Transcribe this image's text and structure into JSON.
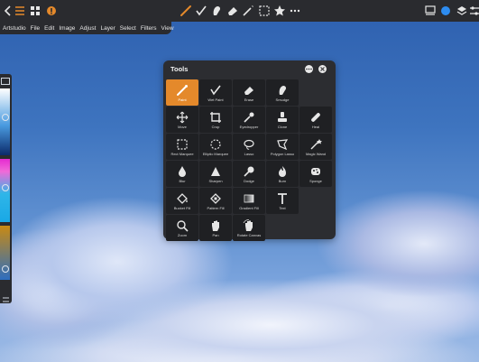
{
  "app": {
    "menu": [
      "Artstudio",
      "File",
      "Edit",
      "Image",
      "Adjust",
      "Layer",
      "Select",
      "Filters",
      "View"
    ]
  },
  "topbar": {
    "left_icons": [
      "back-icon",
      "menu-lines-icon",
      "grid-icon",
      "info-icon"
    ],
    "center_icons": [
      "brush-icon",
      "check-brush-icon",
      "smudge-icon",
      "eraser-icon",
      "selection-icon",
      "star-icon",
      "more-icon"
    ],
    "right_icons": [
      "layers-thumbnail-icon",
      "color-dot-icon",
      "layers-icon",
      "sliders-icon"
    ],
    "accent_color": "#2d8cf0"
  },
  "tools_panel": {
    "title": "Tools",
    "tools": [
      {
        "label": "Paint",
        "icon": "paint-icon",
        "active": true
      },
      {
        "label": "Wet Paint",
        "icon": "wet-paint-icon",
        "active": false
      },
      {
        "label": "Erase",
        "icon": "erase-icon",
        "active": false
      },
      {
        "label": "Smudge",
        "icon": "smudge-icon",
        "active": false
      },
      {
        "label": "",
        "icon": "",
        "active": false
      },
      {
        "label": "Move",
        "icon": "move-icon",
        "active": false
      },
      {
        "label": "Crop",
        "icon": "crop-icon",
        "active": false
      },
      {
        "label": "Eyedropper",
        "icon": "eyedropper-icon",
        "active": false
      },
      {
        "label": "Clone",
        "icon": "clone-icon",
        "active": false
      },
      {
        "label": "Heal",
        "icon": "heal-icon",
        "active": false
      },
      {
        "label": "Rect Marquee",
        "icon": "rect-marquee-icon",
        "active": false
      },
      {
        "label": "Elliptic Marquee",
        "icon": "elliptic-marquee-icon",
        "active": false
      },
      {
        "label": "Lasso",
        "icon": "lasso-icon",
        "active": false
      },
      {
        "label": "Polygon Lasso",
        "icon": "polygon-lasso-icon",
        "active": false
      },
      {
        "label": "Magic Wand",
        "icon": "magic-wand-icon",
        "active": false
      },
      {
        "label": "Blur",
        "icon": "blur-icon",
        "active": false
      },
      {
        "label": "Sharpen",
        "icon": "sharpen-icon",
        "active": false
      },
      {
        "label": "Dodge",
        "icon": "dodge-icon",
        "active": false
      },
      {
        "label": "Burn",
        "icon": "burn-icon",
        "active": false
      },
      {
        "label": "Sponge",
        "icon": "sponge-icon",
        "active": false
      },
      {
        "label": "Bucket Fill",
        "icon": "bucket-fill-icon",
        "active": false
      },
      {
        "label": "Pattern Fill",
        "icon": "pattern-fill-icon",
        "active": false
      },
      {
        "label": "Gradient Fill",
        "icon": "gradient-fill-icon",
        "active": false
      },
      {
        "label": "Text",
        "icon": "text-icon",
        "active": false
      },
      {
        "label": "",
        "icon": "",
        "active": false
      },
      {
        "label": "Zoom",
        "icon": "zoom-icon",
        "active": false
      },
      {
        "label": "Pan",
        "icon": "pan-icon",
        "active": false
      },
      {
        "label": "Rotate Canvas",
        "icon": "rotate-canvas-icon",
        "active": false
      }
    ],
    "active_color": "#e4892b"
  }
}
